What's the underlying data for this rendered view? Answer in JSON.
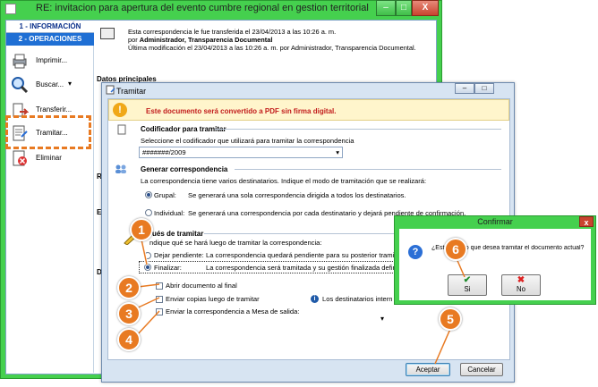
{
  "main_window": {
    "title": "RE: invitacion para apertura del evento cumbre regional en gestion territorial",
    "controls": {
      "minimize": "–",
      "maximize": "□",
      "close": "X"
    }
  },
  "nav": {
    "section1": "1 - INFORMACIÓN",
    "section2": "2 - OPERACIONES",
    "items": [
      {
        "label": "Imprimir...",
        "icon": "printer-icon"
      },
      {
        "label": "Buscar...",
        "icon": "search-icon"
      },
      {
        "label": "Transferir...",
        "icon": "transfer-icon"
      },
      {
        "label": "Tramitar...",
        "icon": "document-process-icon"
      },
      {
        "label": "Eliminar",
        "icon": "delete-icon"
      }
    ],
    "dropdown_arrow": "▾"
  },
  "info": {
    "line1": "Esta correspondencia le fue transferida el 23/04/2013 a las 10:26 a. m.",
    "line2_prefix": "por ",
    "line2_bold": "Administrador, Transparencia Documental",
    "line3": "Última modificación el 23/04/2013 a las 10:26 a. m. por Administrador, Transparencia Documental."
  },
  "side_labels": {
    "datos": "Datos principales",
    "re": "Re",
    "em": "Em",
    "de": "De"
  },
  "tramitar": {
    "title": "Tramitar",
    "warning": "Este documento será convertido a PDF sin firma digital.",
    "codificador": {
      "title": "Codificador para tramitar",
      "hint": "Seleccione el codificador que utilizará para tramitar la correspondencia",
      "value": "#######/2009"
    },
    "generar": {
      "title": "Generar correspondencia",
      "hint": "La correspondencia tiene varios destinatarios. Indique el modo de tramitación que se realizará:",
      "grupal_label": "Grupal:",
      "grupal_desc": "Se generará una sola correspondencia dirigida a todos los destinatarios.",
      "individual_label": "Individual:",
      "individual_desc": "Se generará una correspondencia por cada destinatario y dejará pendiente de confirmación."
    },
    "despues": {
      "title": "ués de tramitar",
      "hint": "ndique qué se hará luego de tramitar la correspondencia:",
      "pendiente_label": "Dejar pendiente:",
      "pendiente_desc": "La correspondencia quedará pendiente para su posterior tramita",
      "finalizar_label": "Finalizar:",
      "finalizar_desc": "La correspondencia será tramitada y su gestión finalizada definit"
    },
    "options": {
      "abrir": "Abrir documento al final",
      "copias": "Enviar copias luego de tramitar",
      "destinatarios_info": "Los destinatarios intern",
      "mesa": "Enviar la correspondencia a Mesa de salida:"
    },
    "buttons": {
      "aceptar": "Aceptar",
      "cancelar": "Cancelar"
    }
  },
  "confirm": {
    "title": "Confirmar",
    "question": "¿Está seguro que desea tramitar el documento actual?",
    "yes": "Si",
    "no": "No"
  },
  "callouts": [
    "1",
    "2",
    "3",
    "4",
    "5",
    "6"
  ],
  "colors": {
    "window_green": "#45d04e",
    "callout_orange": "#e87a22",
    "warning_red": "#c21c1c",
    "nav_blue": "#1f6fd4"
  }
}
